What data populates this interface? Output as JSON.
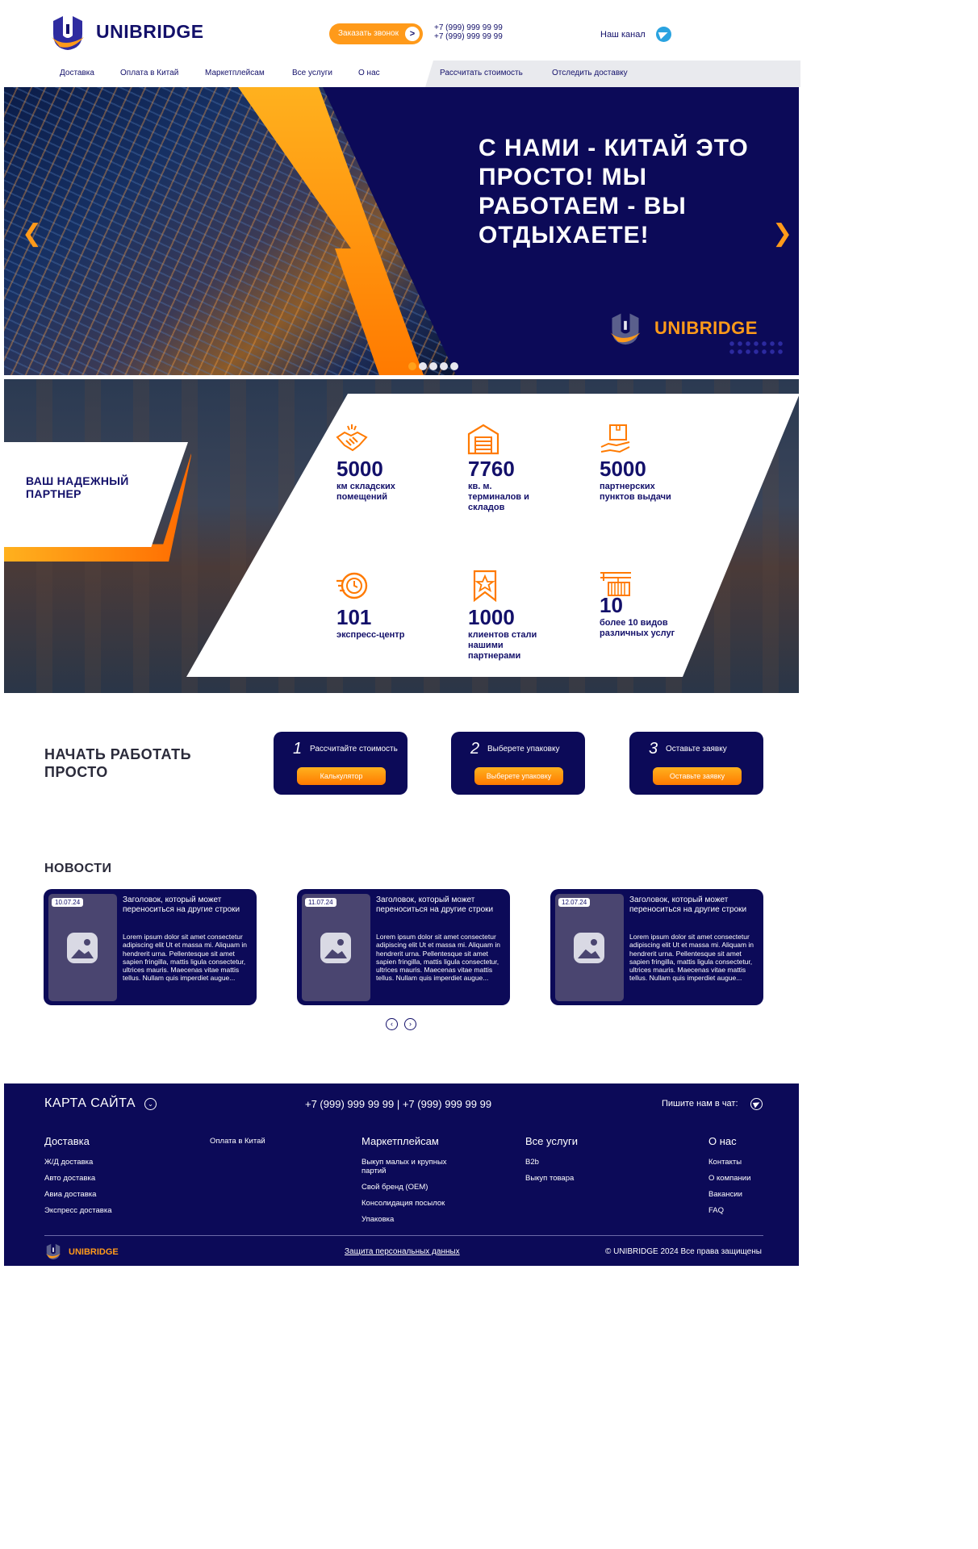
{
  "header": {
    "logo_text": "UNIBRIDGE",
    "call_button": "Заказать звонок",
    "phones": [
      "+7 (999) 999 99 99",
      "+7 (999) 999 99 99"
    ],
    "channel_label": "Наш канал",
    "nav": [
      "Доставка",
      "Оплата в Китай",
      "Маркетплейсам",
      "Все услуги",
      "О нас"
    ],
    "nav_right": [
      "Рассчитать стоимость",
      "Отследить доставку"
    ]
  },
  "hero": {
    "title": "С НАМИ - КИТАЙ ЭТО ПРОСТО! МЫ РАБОТАЕМ - ВЫ ОТДЫХАЕТЕ!",
    "logo_text": "UNIBRIDGE",
    "prev": "❮",
    "next": "❯",
    "slide_count": 5,
    "active_slide": 1
  },
  "partner": {
    "title": "ВАШ НАДЕЖНЫЙ ПАРТНЕР",
    "stats": [
      {
        "icon": "handshake-icon",
        "number": "5000",
        "label": "км складских помещений"
      },
      {
        "icon": "warehouse-icon",
        "number": "7760",
        "label": "кв. м. терминалов и складов"
      },
      {
        "icon": "box-hand-icon",
        "number": "5000",
        "label": "партнерских пунктов выдачи"
      },
      {
        "icon": "express-clock-icon",
        "number": "101",
        "label": "экспресс-центр"
      },
      {
        "icon": "star-bookmark-icon",
        "number": "1000",
        "label": "клиентов стали нашими партнерами"
      },
      {
        "icon": "crane-container-icon",
        "number": "10",
        "label": "более 10 видов различных услуг"
      }
    ]
  },
  "start": {
    "title": "НАЧАТЬ РАБОТАТЬ ПРОСТО",
    "steps": [
      {
        "num": "1",
        "text": "Рассчитайте стоимость",
        "button": "Калькулятор"
      },
      {
        "num": "2",
        "text": "Выберете упаковку",
        "button": "Выберете упаковку"
      },
      {
        "num": "3",
        "text": "Оставьте заявку",
        "button": "Оставьте заявку"
      }
    ]
  },
  "news": {
    "title": "НОВОСТИ",
    "items": [
      {
        "date": "10.07.24",
        "headline": "Заголовок, который может переноситься на другие строки",
        "body": "Lorem ipsum dolor sit amet consectetur adipiscing elit Ut et massa mi. Aliquam in hendrerit urna. Pellentesque sit amet sapien fringilla, mattis ligula consectetur, ultrices mauris. Maecenas vitae mattis tellus. Nullam quis imperdiet augue..."
      },
      {
        "date": "11.07.24",
        "headline": "Заголовок, который может переноситься на другие строки",
        "body": "Lorem ipsum dolor sit amet consectetur adipiscing elit Ut et massa mi. Aliquam in hendrerit urna. Pellentesque sit amet sapien fringilla, mattis ligula consectetur, ultrices mauris. Maecenas vitae mattis tellus. Nullam quis imperdiet augue..."
      },
      {
        "date": "12.07.24",
        "headline": "Заголовок, который может переноситься на другие строки",
        "body": "Lorem ipsum dolor sit amet consectetur adipiscing elit Ut et massa mi. Aliquam in hendrerit urna. Pellentesque sit amet sapien fringilla, mattis ligula consectetur, ultrices mauris. Maecenas vitae mattis tellus. Nullam quis imperdiet augue..."
      }
    ],
    "prev": "‹",
    "next": "›"
  },
  "footer": {
    "sitemap": "КАРТА САЙТА",
    "phones": "+7 (999) 999 99 99  |  +7 (999) 999 99 99",
    "chat": "Пишите нам в чат:",
    "columns": [
      {
        "title": "Доставка",
        "items": [
          "Ж/Д доставка",
          "Авто доставка",
          "Авиа доставка",
          "Экспресс доставка"
        ]
      },
      {
        "title": "Оплата в Китай",
        "items": []
      },
      {
        "title": "Маркетплейсам",
        "items": [
          "Выкуп малых и крупных партий",
          "Свой бренд (OEM)",
          "Консолидация посылок",
          "Упаковка"
        ]
      },
      {
        "title": "Все услуги",
        "items": [
          "B2b",
          "Выкуп товара"
        ]
      },
      {
        "title": "О нас",
        "items": [
          "Контакты",
          "О компании",
          "Вакансии",
          "FAQ"
        ]
      }
    ],
    "logo_text": "UNIBRIDGE",
    "privacy": "Защита персональных данных",
    "copyright": "© UNIBRIDGE 2024 Все права защищены"
  },
  "colors": {
    "navy": "#0c0a58",
    "orange": "#ff9a1a",
    "brand_text": "#13106a"
  }
}
